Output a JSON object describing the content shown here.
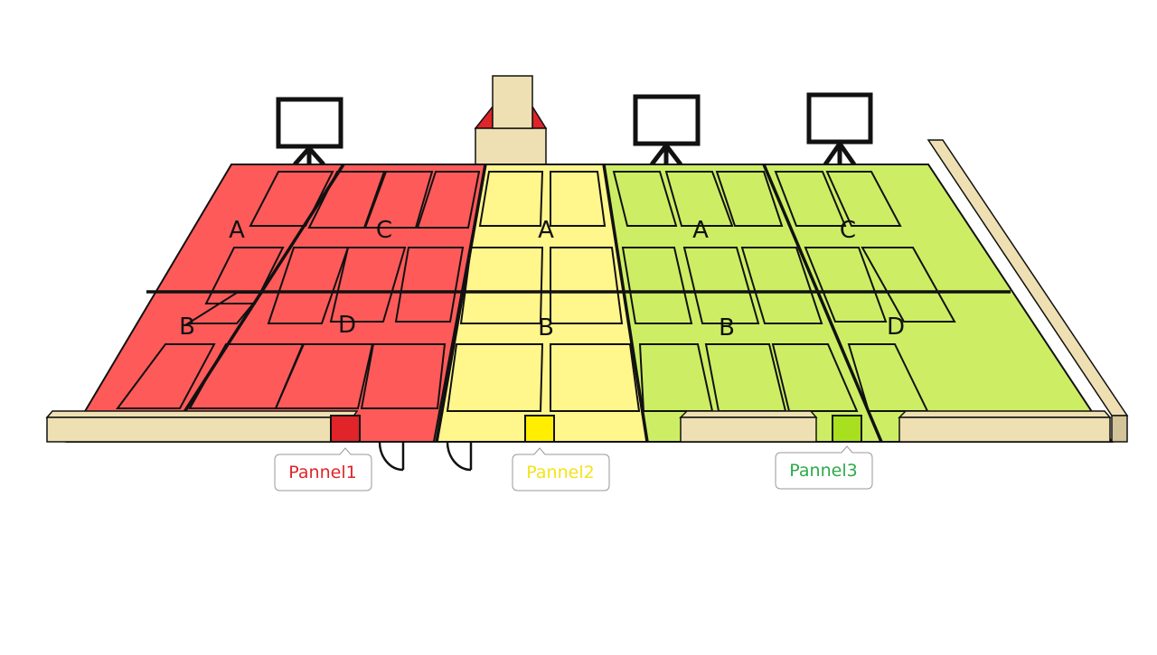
{
  "colors": {
    "panel1": "#ff5a5a",
    "panel2": "#fff68c",
    "panel3": "#cdee64",
    "wall": "#eee0b2",
    "wall_side": "#d4c49a",
    "outline": "#111111",
    "panel1_box": "#e0242a",
    "panel2_box": "#ffee00",
    "panel3_box": "#a8e020",
    "panel1_text": "#e0242a",
    "panel2_text": "#f5e31a",
    "panel3_text": "#2eaa4a"
  },
  "icons": [
    "monitor-icon",
    "monitor-icon",
    "monitor-icon",
    "speaker-tower-icon",
    "door-icon",
    "door-icon"
  ],
  "zones": {
    "panel1_a": "A",
    "panel1_b": "B",
    "panel1_c": "C",
    "panel1_d": "D",
    "panel2_a": "A",
    "panel2_b": "B",
    "panel3_a": "A",
    "panel3_b": "B",
    "panel3_c": "C",
    "panel3_d": "D"
  },
  "panels": {
    "panel1": "Pannel1",
    "panel2": "Pannel2",
    "panel3": "Pannel3"
  }
}
